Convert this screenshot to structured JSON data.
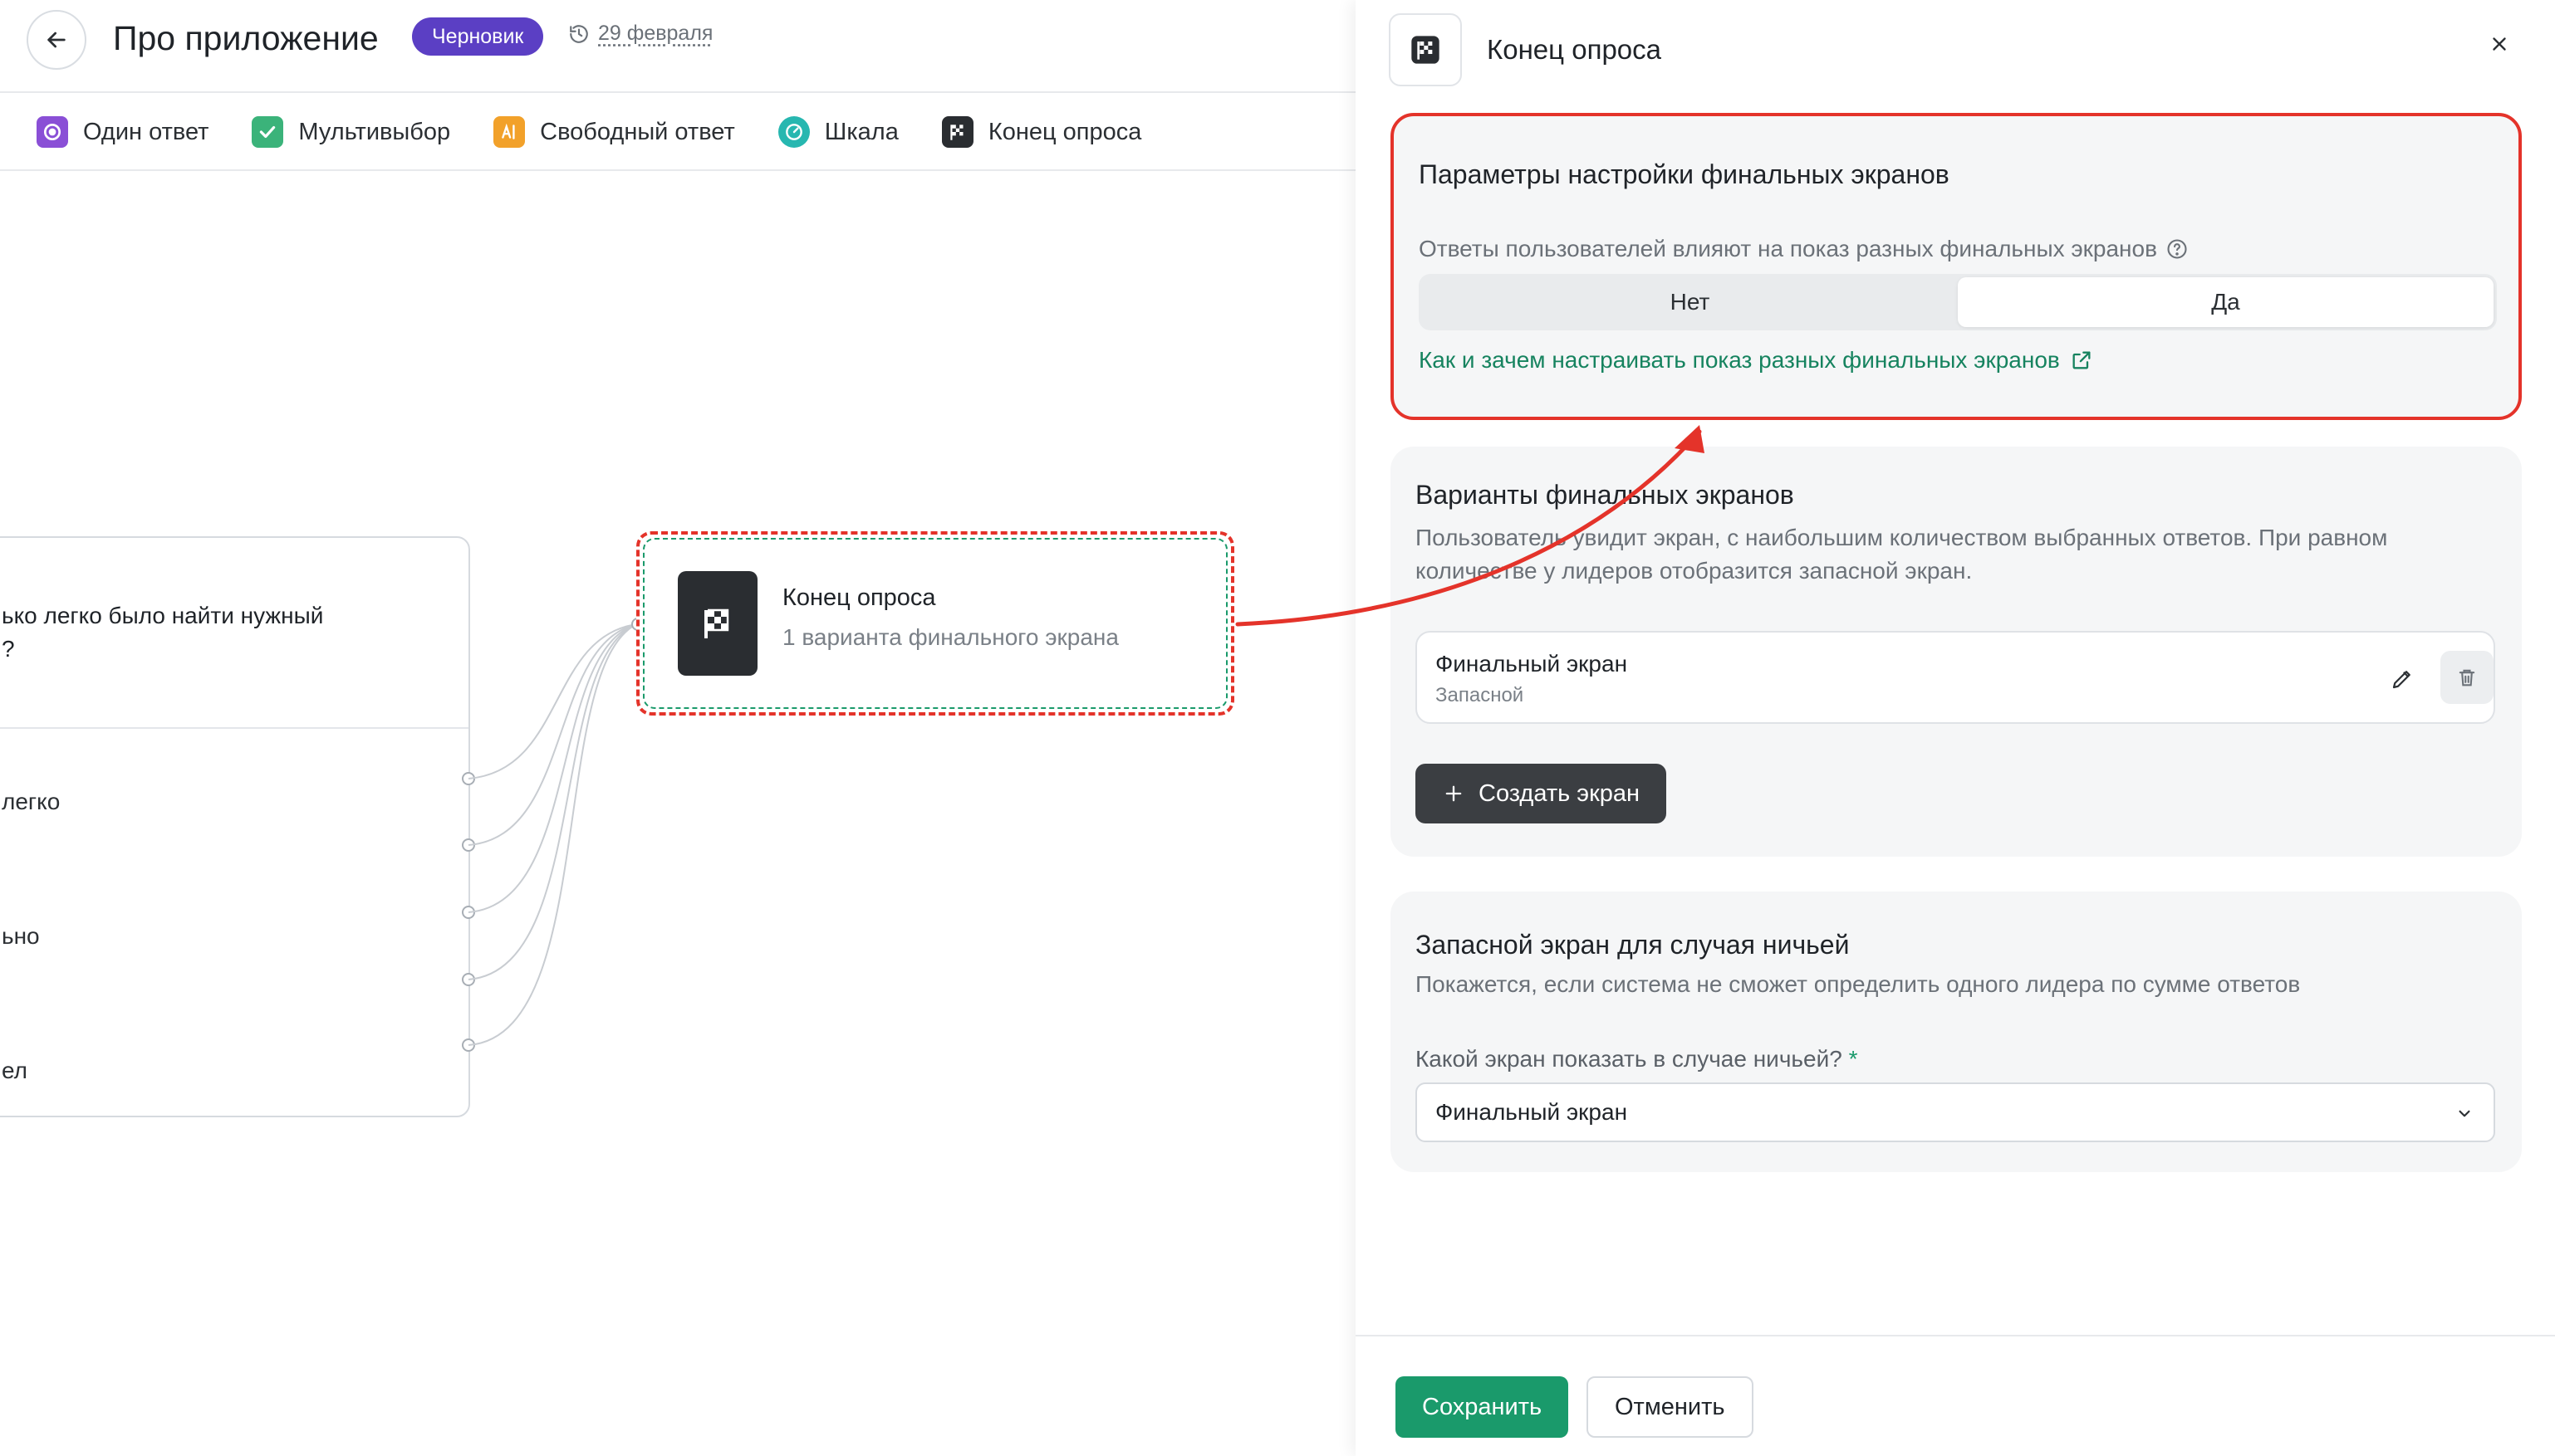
{
  "header": {
    "title": "Про приложение",
    "status_badge": "Черновик",
    "date": "29 февраля"
  },
  "toolbar": {
    "items": [
      {
        "label": "Один ответ",
        "icon": "radio-circle-icon",
        "color": "#8a4fd6"
      },
      {
        "label": "Мультивыбор",
        "icon": "checkbox-check-icon",
        "color": "#3bb37a"
      },
      {
        "label": "Свободный ответ",
        "icon": "text-cursor-icon",
        "color": "#f2a12a"
      },
      {
        "label": "Шкала",
        "icon": "gauge-icon",
        "color": "#27b7b0"
      },
      {
        "label": "Конец опроса",
        "icon": "checkered-flag-icon",
        "color": "#2a2d31"
      }
    ]
  },
  "canvas": {
    "question_card": {
      "title": "ько легко было найти нужный",
      "title_line2": "?",
      "options": [
        "легко",
        "",
        "ьно",
        "",
        "ел"
      ]
    },
    "end_node": {
      "title": "Конец опроса",
      "subtitle": "1 варианта финального экрана"
    }
  },
  "panel": {
    "title": "Конец опроса",
    "settings": {
      "title": "Параметры настройки финальных экранов",
      "question": "Ответы пользователей влияют на показ разных финальных экранов",
      "toggle_no": "Нет",
      "toggle_yes": "Да",
      "selected": "Да",
      "help_link": "Как и зачем настраивать показ разных финальных экранов"
    },
    "variants": {
      "title": "Варианты финальных экранов",
      "description": "Пользователь увидит экран, с наибольшим количеством выбранных ответов. При равном количестве у лидеров отобразится запасной экран.",
      "screen_title": "Финальный экран",
      "screen_subtitle": "Запасной",
      "create_button": "Создать экран"
    },
    "fallback": {
      "title": "Запасной экран для случая ничьей",
      "description": "Покажется, если система не сможет определить одного лидера по сумме ответов",
      "field_label": "Какой экран показать в случае ничьей?",
      "required_mark": "*",
      "selected_value": "Финальный экран"
    },
    "footer": {
      "save": "Сохранить",
      "cancel": "Отменить"
    }
  },
  "colors": {
    "accent_green": "#1a9a6b",
    "draft_purple": "#5b3fc4",
    "highlight_red": "#e4332a"
  }
}
